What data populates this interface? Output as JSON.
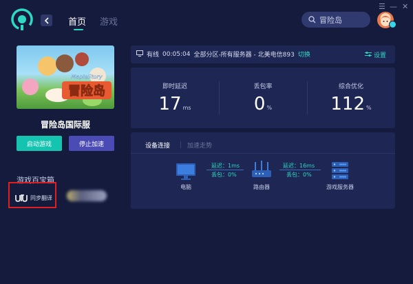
{
  "nav": {
    "home": "首页",
    "games": "游戏"
  },
  "search": {
    "text": "冒险岛"
  },
  "window": {
    "menu": "☰",
    "minimize": "—",
    "close": "✕"
  },
  "game": {
    "title": "冒险岛国际服",
    "cover_logo": "冒险岛",
    "cover_logo_sub": "MapleStory"
  },
  "buttons": {
    "start": "启动游戏",
    "stop": "停止加速"
  },
  "toolbox": {
    "title": "游戏百宝箱",
    "translate_label": "同步翻译"
  },
  "status": {
    "connection": "有线",
    "time": "00:05:04",
    "server_info": "全部分区-所有服务器 - 北美电信893",
    "switch": "切换",
    "settings": "设置"
  },
  "stats": [
    {
      "label": "即时延迟",
      "value": "17",
      "unit": "ms"
    },
    {
      "label": "丢包率",
      "value": "0",
      "unit": "%"
    },
    {
      "label": "综合优化",
      "value": "112",
      "unit": "%"
    }
  ],
  "connection": {
    "tabs": [
      "设备连接",
      "加速走势"
    ],
    "devices": [
      "电脑",
      "路由器",
      "游戏服务器"
    ],
    "links": [
      {
        "latency": "延迟：1ms",
        "loss": "丢包：0%"
      },
      {
        "latency": "延迟：16ms",
        "loss": "丢包：0%"
      }
    ]
  },
  "colors": {
    "background": "#141b3d",
    "panel": "#1e2753",
    "accent": "#2ed8c3",
    "stop_button": "#4b4bb5",
    "highlight_box": "#e02020"
  }
}
